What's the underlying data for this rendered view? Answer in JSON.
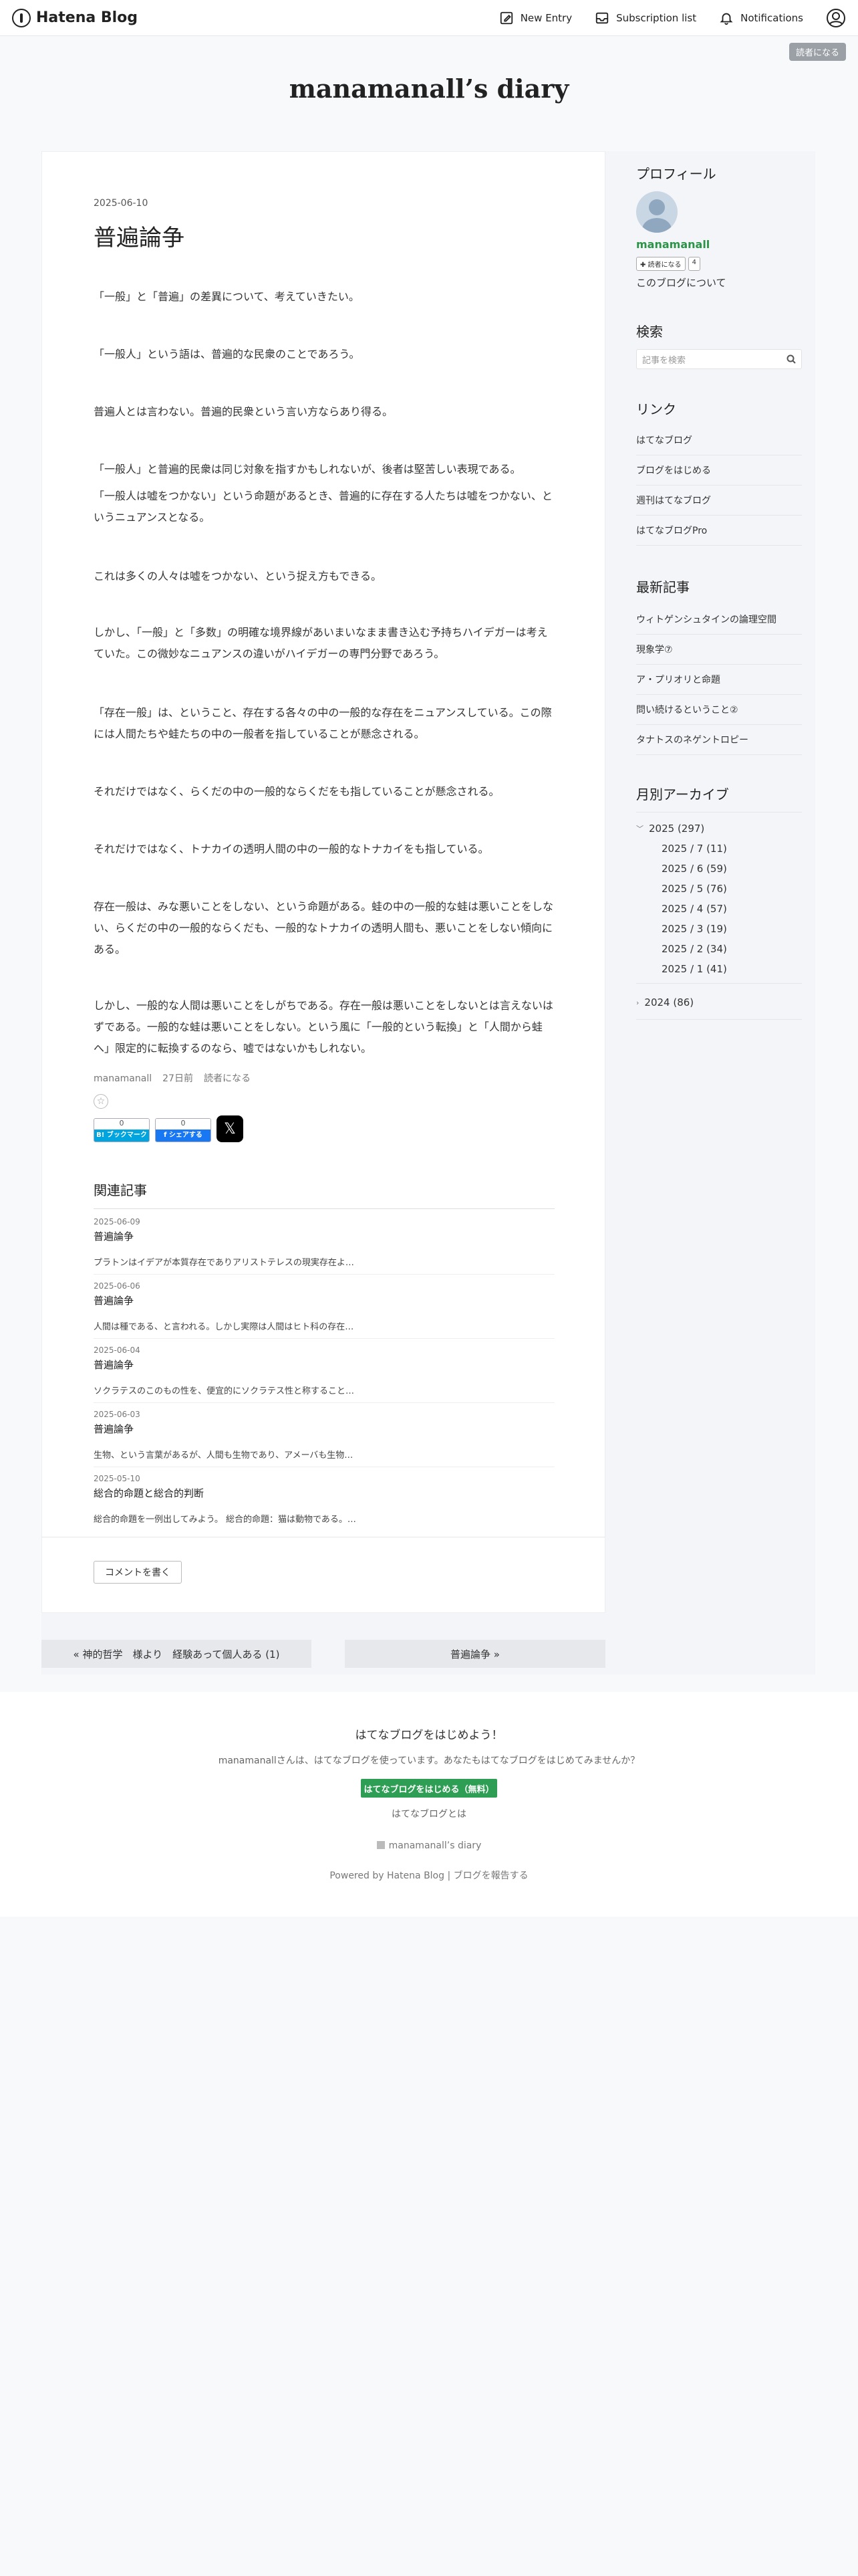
{
  "navbar": {
    "logo": "Hatena Blog",
    "new_entry": "New Entry",
    "subscription": "Subscription list",
    "notifications": "Notifications"
  },
  "follow_top": "読者になる",
  "blog_title": "manamanall’s diary",
  "entry": {
    "date": "2025-06-10",
    "title": "普遍論争",
    "paragraphs": [
      "「一般」と「普遍」の差異について、考えていきたい。",
      "「一般人」という語は、普遍的な民衆のことであろう。",
      "普遍人とは言わない。普遍的民衆という言い方ならあり得る。",
      "「一般人」と普遍的民衆は同じ対象を指すかもしれないが、後者は堅苦しい表現である。",
      "「一般人は嘘をつかない」という命題があるとき、普遍的に存在する人たちは嘘をつかない、というニュアンスとなる。",
      "これは多くの人々は嘘をつかない、という捉え方もできる。",
      "しかし、「一般」と「多数」の明確な境界線があいまいなまま書き込む予持ちハイデガーは考えていた。この微妙なニュアンスの違いがハイデガーの専門分野であろう。",
      "「存在一般」は、ということ、存在する各々の中の一般的な存在をニュアンスしている。この際には人間たちや蛙たちの中の一般者を指していることが懸念される。",
      "それだけではなく、らくだの中の一般的ならくだをも指していることが懸念される。",
      "それだけではなく、トナカイの透明人間の中の一般的なトナカイをも指している。",
      "存在一般は、みな悪いことをしない、という命題がある。蛙の中の一般的な蛙は悪いことをしない、らくだの中の一般的ならくだも、一般的なトナカイの透明人間も、悪いことをしない傾向にある。",
      "しかし、一般的な人間は悪いことをしがちである。存在一般は悪いことをしないとは言えないはずである。一般的な蛙は悪いことをしない。という風に「一般的という転換」と「人間から蛙へ」限定的に転換するのなら、嘘ではないかもしれない。"
    ],
    "author": "manamanall",
    "ago": "27日前",
    "reader_link": "読者になる",
    "bookmark_count": "0",
    "bookmark_label": "B! ブックマーク",
    "share_count": "0",
    "share_label": "f シェアする",
    "x_label": "𝕏"
  },
  "related": {
    "heading": "関連記事",
    "items": [
      {
        "date": "2025-06-09",
        "title": "普遍論争",
        "excerpt": "プラトンはイデアが本質存在でありアリストテレスの現実存在よ…"
      },
      {
        "date": "2025-06-06",
        "title": "普遍論争",
        "excerpt": "人間は種である、と言われる。しかし実際は人間はヒト科の存在…"
      },
      {
        "date": "2025-06-04",
        "title": "普遍論争",
        "excerpt": "ソクラテスのこのもの性を、便宜的にソクラテス性と称すること…"
      },
      {
        "date": "2025-06-03",
        "title": "普遍論争",
        "excerpt": "生物、という言葉があるが、人間も生物であり、アメーバも生物…"
      },
      {
        "date": "2025-05-10",
        "title": "総合的命題と総合的判断",
        "excerpt": "総合的命題を一例出してみよう。 総合的命題：猫は動物である。…"
      }
    ]
  },
  "comment_button": "コメントを書く",
  "pager": {
    "prev": "« 神的哲学　様より　経験あって個人ある (1)",
    "next": "普遍論争 »"
  },
  "sidebar": {
    "profile_heading": "プロフィール",
    "profile_name": "manamanall",
    "follow_label": "✚ 読者になる",
    "follow_count": "4",
    "about": "このブログについて",
    "search_heading": "検索",
    "search_placeholder": "記事を検索",
    "links_heading": "リンク",
    "links": [
      "はてなブログ",
      "ブログをはじめる",
      "週刊はてなブログ",
      "はてなブログPro"
    ],
    "recent_heading": "最新記事",
    "recent": [
      "ウィトゲンシュタインの論理空間",
      "現象学⑦",
      "ア・プリオリと命題",
      "問い続けるということ②",
      "タナトスのネゲントロピー"
    ],
    "archive_heading": "月別アーカイブ",
    "archive_2025": "2025 (297)",
    "archive_months": [
      "2025 / 7 (11)",
      "2025 / 6 (59)",
      "2025 / 5 (76)",
      "2025 / 4 (57)",
      "2025 / 3 (19)",
      "2025 / 2 (34)",
      "2025 / 1 (41)"
    ],
    "archive_2024": "2024 (86)"
  },
  "footer": {
    "heading": "はてなブログをはじめよう！",
    "text": "manamanallさんは、はてなブログを使っています。あなたもはてなブログをはじめてみませんか？",
    "cta": "はてなブログをはじめる（無料）",
    "about": "はてなブログとは",
    "diary": "manamanall’s diary",
    "powered": "Powered by Hatena Blog | ブログを報告する"
  },
  "colors": {
    "accent_green": "#2e9e54",
    "bookmark_blue": "#00a4de",
    "facebook_blue": "#1877f2"
  }
}
